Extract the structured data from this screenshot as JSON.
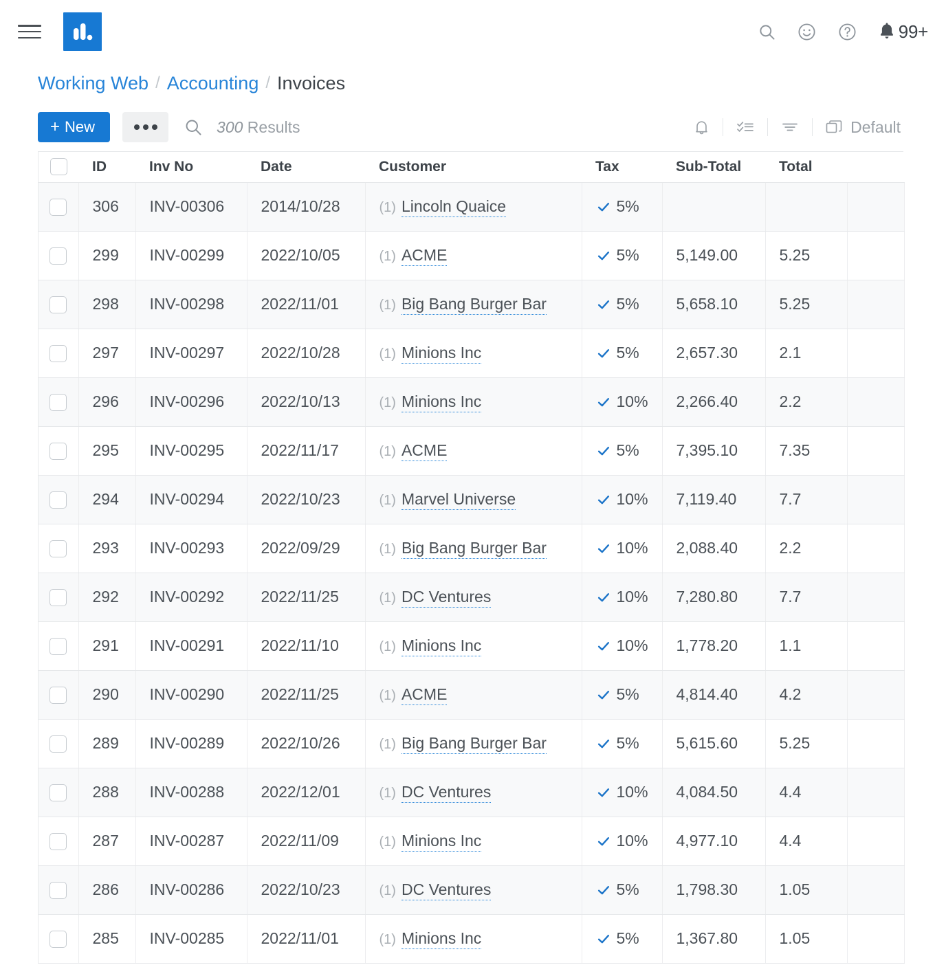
{
  "topbar": {
    "menu_icon": "hamburger-icon",
    "logo_icon": "bar-chart-logo",
    "search_icon": "search-icon",
    "feedback_icon": "smiley-face-icon",
    "help_icon": "question-mark-icon",
    "notification_icon": "bell-filled-icon",
    "notification_count": "99+"
  },
  "breadcrumb": {
    "items": [
      {
        "label": "Working Web",
        "link": true
      },
      {
        "label": "Accounting",
        "link": true
      },
      {
        "label": "Invoices",
        "link": false
      }
    ],
    "separator": "/"
  },
  "toolbar": {
    "new_label": "New",
    "new_plus": "+",
    "more_icon": "ellipsis-icon",
    "search_icon": "search-icon",
    "results_count": "300",
    "results_label": "Results",
    "bell_icon": "bell-outline-icon",
    "checklist_icon": "checklist-icon",
    "filter_icon": "filter-icon",
    "view_icon": "layers-icon",
    "view_label": "Default"
  },
  "table": {
    "columns": [
      "ID",
      "Inv No",
      "Date",
      "Customer",
      "Tax",
      "Sub-Total",
      "Total"
    ],
    "select_all": false,
    "rows": [
      {
        "id": "306",
        "inv_no": "INV-00306",
        "date": "2014/10/28",
        "cust_idx": "(1)",
        "customer": "Lincoln Quaice",
        "tax": "5%",
        "sub_total": "",
        "total": ""
      },
      {
        "id": "299",
        "inv_no": "INV-00299",
        "date": "2022/10/05",
        "cust_idx": "(1)",
        "customer": "ACME",
        "tax": "5%",
        "sub_total": "5,149.00",
        "total": "5.25"
      },
      {
        "id": "298",
        "inv_no": "INV-00298",
        "date": "2022/11/01",
        "cust_idx": "(1)",
        "customer": "Big Bang Burger Bar",
        "tax": "5%",
        "sub_total": "5,658.10",
        "total": "5.25"
      },
      {
        "id": "297",
        "inv_no": "INV-00297",
        "date": "2022/10/28",
        "cust_idx": "(1)",
        "customer": "Minions Inc",
        "tax": "5%",
        "sub_total": "2,657.30",
        "total": "2.1"
      },
      {
        "id": "296",
        "inv_no": "INV-00296",
        "date": "2022/10/13",
        "cust_idx": "(1)",
        "customer": "Minions Inc",
        "tax": "10%",
        "sub_total": "2,266.40",
        "total": "2.2"
      },
      {
        "id": "295",
        "inv_no": "INV-00295",
        "date": "2022/11/17",
        "cust_idx": "(1)",
        "customer": "ACME",
        "tax": "5%",
        "sub_total": "7,395.10",
        "total": "7.35"
      },
      {
        "id": "294",
        "inv_no": "INV-00294",
        "date": "2022/10/23",
        "cust_idx": "(1)",
        "customer": "Marvel Universe",
        "tax": "10%",
        "sub_total": "7,119.40",
        "total": "7.7"
      },
      {
        "id": "293",
        "inv_no": "INV-00293",
        "date": "2022/09/29",
        "cust_idx": "(1)",
        "customer": "Big Bang Burger Bar",
        "tax": "10%",
        "sub_total": "2,088.40",
        "total": "2.2"
      },
      {
        "id": "292",
        "inv_no": "INV-00292",
        "date": "2022/11/25",
        "cust_idx": "(1)",
        "customer": "DC Ventures",
        "tax": "10%",
        "sub_total": "7,280.80",
        "total": "7.7"
      },
      {
        "id": "291",
        "inv_no": "INV-00291",
        "date": "2022/11/10",
        "cust_idx": "(1)",
        "customer": "Minions Inc",
        "tax": "10%",
        "sub_total": "1,778.20",
        "total": "1.1"
      },
      {
        "id": "290",
        "inv_no": "INV-00290",
        "date": "2022/11/25",
        "cust_idx": "(1)",
        "customer": "ACME",
        "tax": "5%",
        "sub_total": "4,814.40",
        "total": "4.2"
      },
      {
        "id": "289",
        "inv_no": "INV-00289",
        "date": "2022/10/26",
        "cust_idx": "(1)",
        "customer": "Big Bang Burger Bar",
        "tax": "5%",
        "sub_total": "5,615.60",
        "total": "5.25"
      },
      {
        "id": "288",
        "inv_no": "INV-00288",
        "date": "2022/12/01",
        "cust_idx": "(1)",
        "customer": "DC Ventures",
        "tax": "10%",
        "sub_total": "4,084.50",
        "total": "4.4"
      },
      {
        "id": "287",
        "inv_no": "INV-00287",
        "date": "2022/11/09",
        "cust_idx": "(1)",
        "customer": "Minions Inc",
        "tax": "10%",
        "sub_total": "4,977.10",
        "total": "4.4"
      },
      {
        "id": "286",
        "inv_no": "INV-00286",
        "date": "2022/10/23",
        "cust_idx": "(1)",
        "customer": "DC Ventures",
        "tax": "5%",
        "sub_total": "1,798.30",
        "total": "1.05"
      },
      {
        "id": "285",
        "inv_no": "INV-00285",
        "date": "2022/11/01",
        "cust_idx": "(1)",
        "customer": "Minions Inc",
        "tax": "5%",
        "sub_total": "1,367.80",
        "total": "1.05"
      }
    ]
  },
  "colors": {
    "accent_blue": "#1779d3",
    "link_blue": "#2784d8",
    "check_blue": "#1a73c8",
    "text_dark": "#3d4349",
    "text_body": "#4b5157",
    "muted": "#9aa0a6",
    "row_alt": "#f8f9fa",
    "border": "#e6e8ea"
  }
}
